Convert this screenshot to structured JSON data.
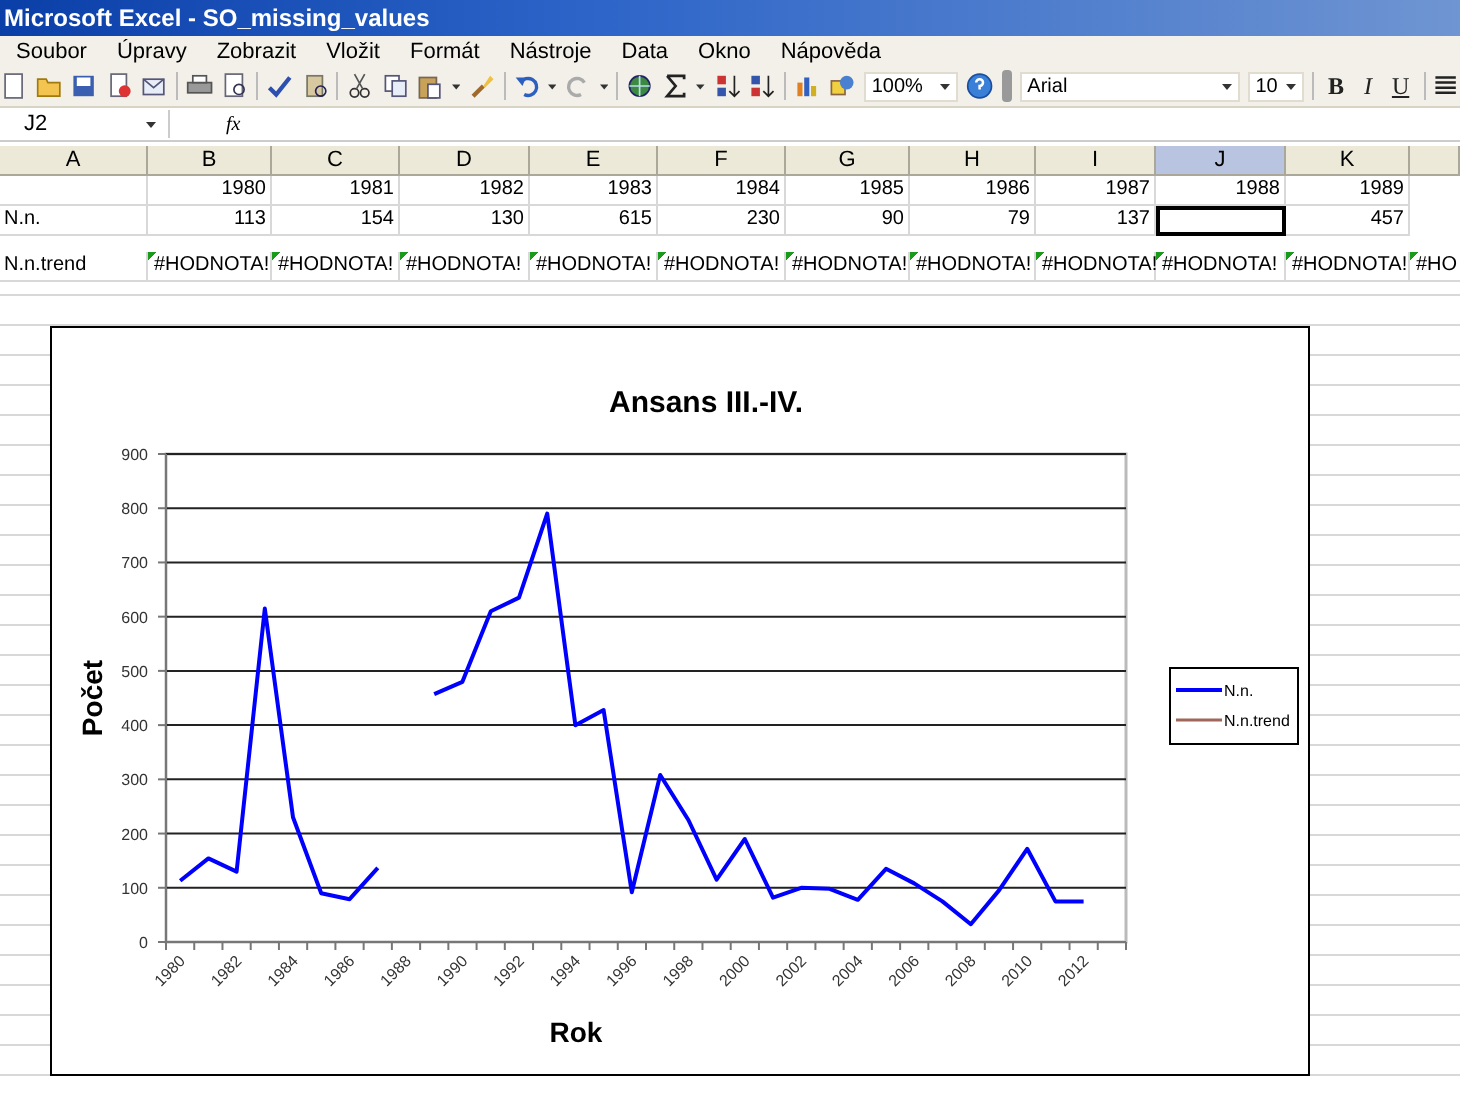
{
  "window": {
    "title": "Microsoft Excel - SO_missing_values"
  },
  "menu": [
    "Soubor",
    "Úpravy",
    "Zobrazit",
    "Vložit",
    "Formát",
    "Nástroje",
    "Data",
    "Okno",
    "Nápověda"
  ],
  "toolbar": {
    "zoom": "100%",
    "font": "Arial",
    "font_size": "10",
    "format_buttons": [
      "B",
      "I",
      "U"
    ]
  },
  "formula_bar": {
    "name_box": "J2",
    "fx": "fx"
  },
  "sheet": {
    "columns": [
      {
        "label": "A",
        "selected": false
      },
      {
        "label": "B",
        "selected": false
      },
      {
        "label": "C",
        "selected": false
      },
      {
        "label": "D",
        "selected": false
      },
      {
        "label": "E",
        "selected": false
      },
      {
        "label": "F",
        "selected": false
      },
      {
        "label": "G",
        "selected": false
      },
      {
        "label": "H",
        "selected": false
      },
      {
        "label": "I",
        "selected": false
      },
      {
        "label": "J",
        "selected": true
      },
      {
        "label": "K",
        "selected": false
      }
    ],
    "rows": [
      {
        "kind": "number",
        "cells": [
          {
            "selected": false
          },
          {
            "text": "1980",
            "selected": false
          },
          {
            "text": "1981",
            "selected": false
          },
          {
            "text": "1982",
            "selected": false
          },
          {
            "text": "1983",
            "selected": false
          },
          {
            "text": "1984",
            "selected": false
          },
          {
            "text": "1985",
            "selected": false
          },
          {
            "text": "1986",
            "selected": false
          },
          {
            "text": "1987",
            "selected": false
          },
          {
            "text": "1988",
            "selected": false
          },
          {
            "text": "1989",
            "selected": false
          }
        ]
      },
      {
        "kind": "number",
        "cells": [
          {
            "text": "N.n.",
            "selected": false
          },
          {
            "text": "113",
            "selected": false
          },
          {
            "text": "154",
            "selected": false
          },
          {
            "text": "130",
            "selected": false
          },
          {
            "text": "615",
            "selected": false
          },
          {
            "text": "230",
            "selected": false
          },
          {
            "text": "90",
            "selected": false
          },
          {
            "text": "79",
            "selected": false
          },
          {
            "text": "137",
            "selected": false
          },
          {
            "selected": true
          },
          {
            "text": "457",
            "selected": false
          }
        ]
      },
      {
        "kind": "empty"
      },
      {
        "kind": "error",
        "cells": [
          {
            "text": "N.n.trend",
            "selected": false
          },
          {
            "text": "#HODNOTA!",
            "selected": false
          },
          {
            "text": "#HODNOTA!",
            "selected": false
          },
          {
            "text": "#HODNOTA!",
            "selected": false
          },
          {
            "text": "#HODNOTA!",
            "selected": false
          },
          {
            "text": "#HODNOTA!",
            "selected": false
          },
          {
            "text": "#HODNOTA!",
            "selected": false
          },
          {
            "text": "#HODNOTA!",
            "selected": false
          },
          {
            "text": "#HODNOTA!",
            "selected": false
          },
          {
            "text": "#HODNOTA!",
            "selected": false
          },
          {
            "text": "#HODNOTA!",
            "selected": false
          },
          {
            "text": "#HO",
            "selected": false
          }
        ]
      }
    ]
  },
  "chart": {
    "chart_data": {
      "type": "line",
      "title": "Ansans III.-IV.",
      "xlabel": "Rok",
      "ylabel": "Počet",
      "categories": [
        "1980",
        null,
        "1982",
        null,
        "1984",
        null,
        "1986",
        null,
        "1988",
        null,
        "1990",
        null,
        "1992",
        null,
        "1994",
        null,
        "1996",
        null,
        "1998",
        null,
        "2000",
        null,
        "2002",
        null,
        "2004",
        null,
        "2006",
        null,
        "2008",
        null,
        "2010",
        null,
        "2012",
        null
      ],
      "series": [
        {
          "name": "N.n.",
          "color": "#0000ff",
          "values": [
            113,
            154,
            130,
            615,
            230,
            90,
            79,
            137,
            null,
            457,
            480,
            610,
            635,
            790,
            400,
            428,
            92,
            308,
            225,
            115,
            190,
            82,
            100,
            98,
            78,
            135,
            108,
            75,
            33,
            95,
            172,
            75,
            75,
            null
          ]
        },
        {
          "name": "N.n.trend",
          "color": "#a0665a",
          "values": [
            null,
            null,
            null,
            null,
            null,
            null,
            null,
            null,
            null,
            null,
            null,
            null,
            null,
            null,
            null,
            null,
            null,
            null,
            null,
            null,
            null,
            null,
            null,
            null,
            null,
            null,
            null,
            null,
            null,
            null,
            null,
            null,
            null,
            null
          ]
        }
      ],
      "ylim": [
        0,
        900
      ],
      "yticks": [
        0,
        100,
        200,
        300,
        400,
        500,
        600,
        700,
        800,
        900
      ],
      "grid": true
    }
  }
}
